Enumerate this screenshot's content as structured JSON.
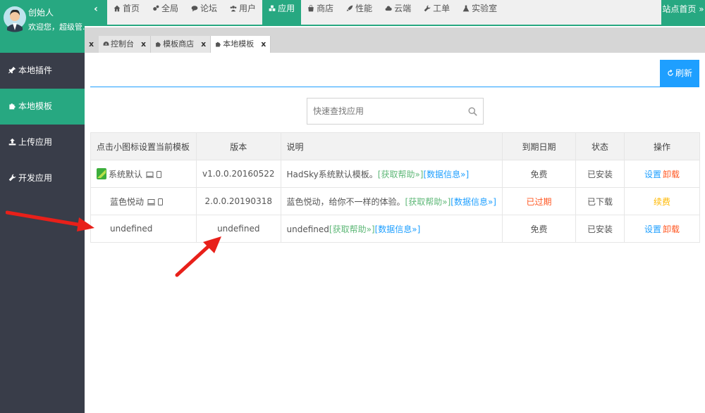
{
  "user": {
    "name": "创始人",
    "welcome": "欢迎您，超级管..."
  },
  "sidebar": {
    "items": [
      {
        "label": "本地插件",
        "icon": "plug-icon"
      },
      {
        "label": "本地模板",
        "icon": "puzzle-icon"
      },
      {
        "label": "上传应用",
        "icon": "upload-icon"
      },
      {
        "label": "开发应用",
        "icon": "wrench-icon"
      }
    ],
    "active_index": 1
  },
  "topnav": {
    "collapse": "‹",
    "items": [
      {
        "label": "首页",
        "icon": "home-icon"
      },
      {
        "label": "全局",
        "icon": "cogs-icon"
      },
      {
        "label": "论坛",
        "icon": "comments-icon"
      },
      {
        "label": "用户",
        "icon": "users-icon"
      },
      {
        "label": "应用",
        "icon": "cubes-icon"
      },
      {
        "label": "商店",
        "icon": "shopping-bag-icon"
      },
      {
        "label": "性能",
        "icon": "rocket-icon"
      },
      {
        "label": "云端",
        "icon": "cloud-icon"
      },
      {
        "label": "工单",
        "icon": "wrench-icon"
      },
      {
        "label": "实验室",
        "icon": "flask-icon"
      }
    ],
    "active_index": 4,
    "site_home": "站点首页 »"
  },
  "tabs": {
    "close_all": "x",
    "items": [
      {
        "label": "控制台",
        "icon": "dashboard-icon",
        "close": "x"
      },
      {
        "label": "模板商店",
        "icon": "puzzle-icon",
        "close": "x"
      },
      {
        "label": "本地模板",
        "icon": "puzzle-icon",
        "close": "x"
      }
    ],
    "active_index": 2
  },
  "toolbar": {
    "refresh_label": "刷新"
  },
  "search": {
    "placeholder": "快速查找应用"
  },
  "table": {
    "headers": [
      "点击小图标设置当前模板",
      "版本",
      "说明",
      "到期日期",
      "状态",
      "操作"
    ],
    "rows": [
      {
        "name": "系统默认",
        "has_thumb": true,
        "version": "v1.0.0.20160522",
        "desc": "HadSky系统默认模板。",
        "help": "[获取帮助»]",
        "info": "[数据信息»]",
        "expiry": "免费",
        "expiry_color": "#555555",
        "status": "已安装",
        "actions": [
          {
            "label": "设置",
            "color": "#1e9fff"
          },
          {
            "label": "卸载",
            "color": "#ff5722"
          }
        ]
      },
      {
        "name": "蓝色悦动",
        "has_thumb": false,
        "version": "2.0.0.20190318",
        "desc": "蓝色悦动，给你不一样的体验。",
        "help": "[获取帮助»]",
        "info": "[数据信息»]",
        "expiry": "已过期",
        "expiry_color": "#ff5722",
        "status": "已下载",
        "actions": [
          {
            "label": "续费",
            "color": "#ffb800"
          }
        ]
      },
      {
        "name": "undefined",
        "has_thumb": false,
        "version": "undefined",
        "desc": "undefined",
        "help": "[获取帮助»]",
        "info": "[数据信息»]",
        "expiry": "免费",
        "expiry_color": "#555555",
        "status": "已安装",
        "actions": [
          {
            "label": "设置",
            "color": "#1e9fff"
          },
          {
            "label": "卸载",
            "color": "#ff5722"
          }
        ]
      }
    ]
  },
  "colors": {
    "accent": "#27a881",
    "sidebar_bg": "#393d49",
    "primary": "#1e9fff",
    "annotation_arrow": "#e8201a"
  }
}
